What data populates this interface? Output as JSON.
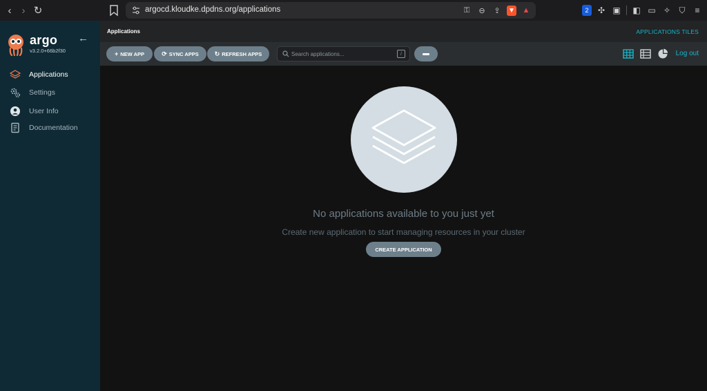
{
  "browser": {
    "url": "argocd.kloudke.dpdns.org/applications",
    "back_glyph": "‹",
    "forward_glyph": "›",
    "reload_glyph": "↻",
    "bitwarden_badge": "2"
  },
  "sidebar": {
    "logo_text": "argo",
    "version": "v3.2.0+66b2f30",
    "items": [
      {
        "label": "Applications",
        "icon": "layers-icon",
        "active": true
      },
      {
        "label": "Settings",
        "icon": "gears-icon",
        "active": false
      },
      {
        "label": "User Info",
        "icon": "user-circle-icon",
        "active": false
      },
      {
        "label": "Documentation",
        "icon": "book-icon",
        "active": false
      }
    ]
  },
  "header": {
    "breadcrumb": "Applications",
    "view_title": "APPLICATIONS TILES"
  },
  "toolbar": {
    "new_app": "NEW APP",
    "sync_apps": "SYNC APPS",
    "refresh_apps": "REFRESH APPS",
    "search_placeholder": "Search applications...",
    "search_shortcut": "/",
    "logout": "Log out"
  },
  "empty_state": {
    "title": "No applications available to you just yet",
    "subtitle": "Create new application to start managing resources in your cluster",
    "create_button": "CREATE APPLICATION"
  },
  "colors": {
    "sidebar_bg": "#0f2a35",
    "accent": "#19b6c9",
    "button_bg": "#6d7f8b",
    "main_bg": "#121212"
  }
}
